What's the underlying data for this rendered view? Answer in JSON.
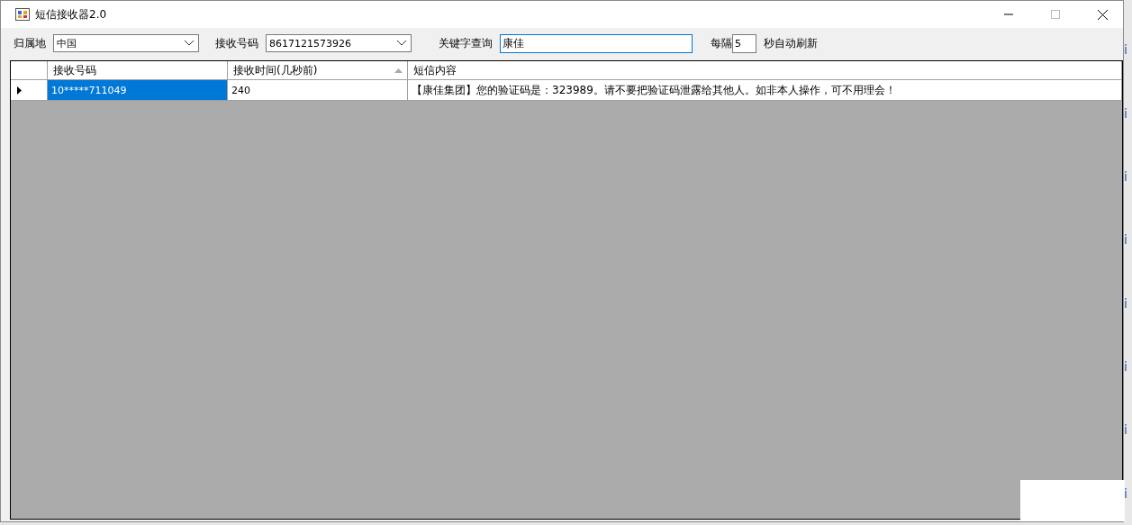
{
  "window": {
    "title": "短信接收器2.0"
  },
  "toolbar": {
    "region_label": "归属地",
    "region_value": "中国",
    "number_label": "接收号码",
    "number_value": "8617121573926",
    "keyword_label": "关键字查询",
    "keyword_value": "康佳",
    "interval_prefix": "每隔",
    "interval_value": "5",
    "interval_suffix": "秒自动刷新"
  },
  "table": {
    "columns": [
      {
        "label": "接收号码",
        "sorted": false
      },
      {
        "label": "接收时间(几秒前)",
        "sorted": true
      },
      {
        "label": "短信内容",
        "sorted": false
      }
    ],
    "rows": [
      {
        "current": true,
        "cells": [
          {
            "text": "10*****711049",
            "selected": true
          },
          {
            "text": "240",
            "selected": false
          },
          {
            "text": "【康佳集团】您的验证码是：323989。请不要把验证码泄露给其他人。如非本人操作，可不用理会！",
            "selected": false
          }
        ]
      }
    ]
  },
  "background_fragments": [
    "i",
    "i",
    "i",
    "i",
    "i",
    "i",
    "i",
    "i"
  ]
}
